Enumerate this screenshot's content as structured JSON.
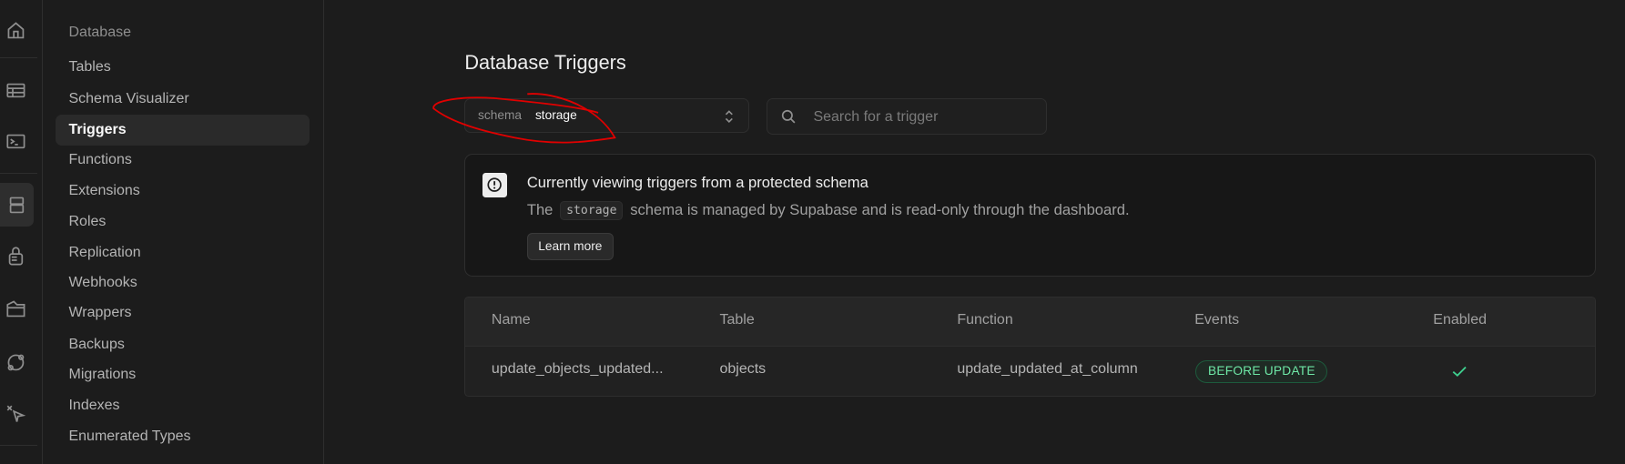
{
  "rail": {
    "icons": [
      "home-icon",
      "table-editor-icon",
      "sql-editor-icon",
      "database-icon",
      "auth-lock-icon",
      "storage-folder-icon",
      "realtime-icon",
      "edge-functions-icon"
    ]
  },
  "menu": {
    "heading": "Database",
    "items": [
      "Tables",
      "Schema Visualizer",
      "Triggers",
      "Functions",
      "Extensions",
      "Roles",
      "Replication",
      "Webhooks",
      "Wrappers",
      "Backups",
      "Migrations",
      "Indexes",
      "Enumerated Types"
    ],
    "selected": "Triggers"
  },
  "page": {
    "title": "Database Triggers"
  },
  "schema_select": {
    "label": "schema",
    "value": "storage"
  },
  "search": {
    "placeholder": "Search for a trigger"
  },
  "alert": {
    "title": "Currently viewing triggers from a protected schema",
    "desc_prefix": "The",
    "desc_code": "storage",
    "desc_suffix": "schema is managed by Supabase and is read-only through the dashboard.",
    "button": "Learn more"
  },
  "table": {
    "columns": [
      "Name",
      "Table",
      "Function",
      "Events",
      "Enabled"
    ],
    "rows": [
      {
        "name": "update_objects_updated...",
        "table": "objects",
        "function": "update_updated_at_column",
        "events": "BEFORE UPDATE",
        "enabled": true
      }
    ]
  },
  "colors": {
    "accent_green": "#3ecf8e",
    "annotation_red": "#e00000"
  }
}
